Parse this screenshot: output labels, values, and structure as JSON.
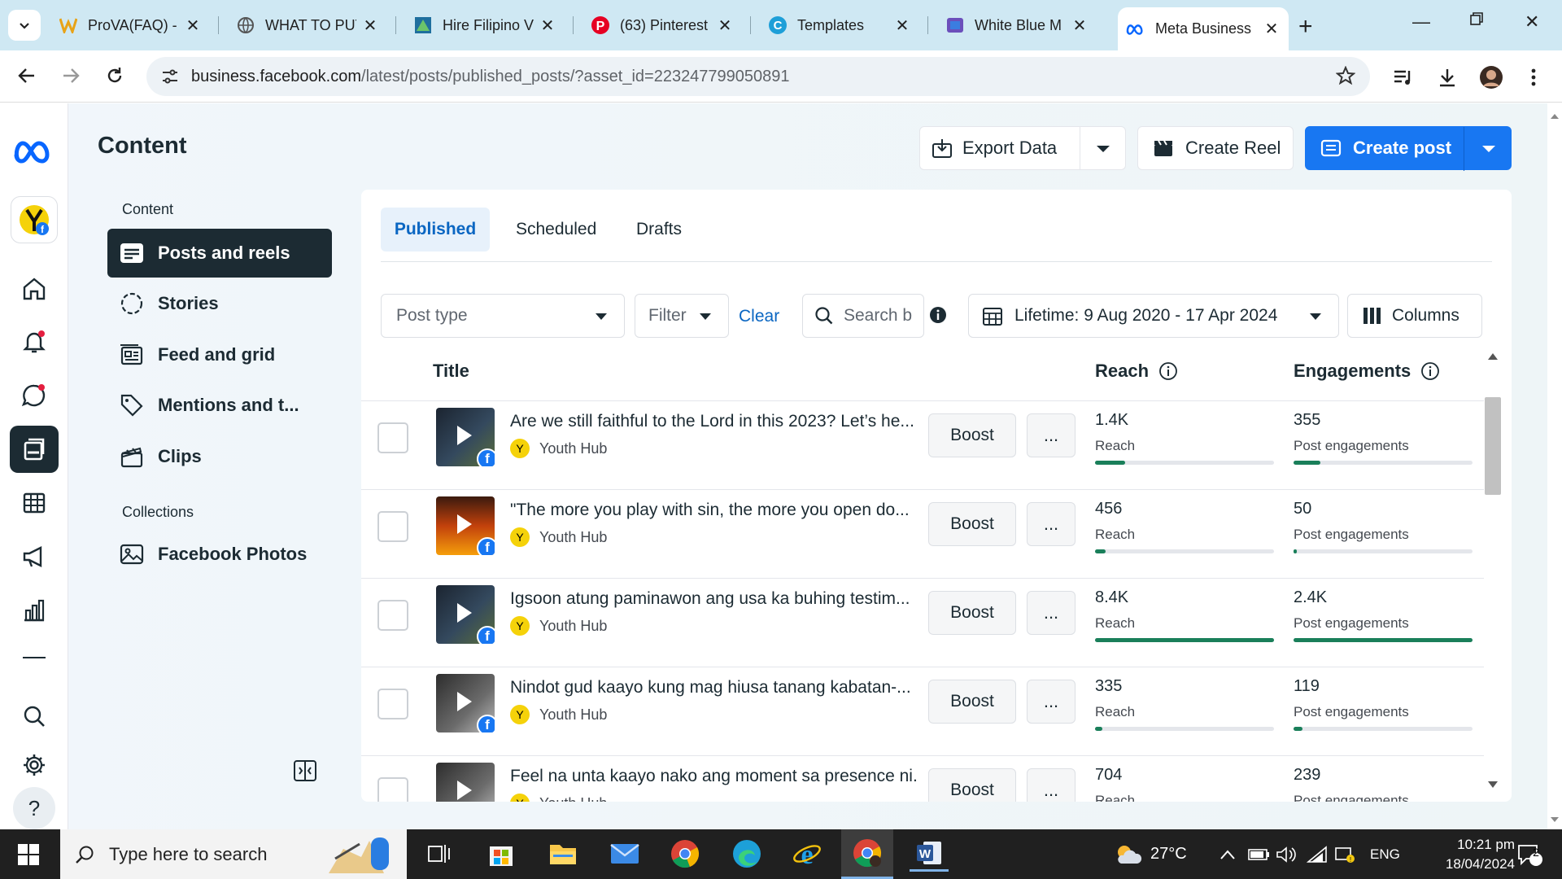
{
  "browser": {
    "tabs": [
      {
        "label": "ProVA(FAQ) - ",
        "icon": "wps-icon",
        "active": false
      },
      {
        "label": "WHAT TO PUT",
        "icon": "globe-icon",
        "active": false
      },
      {
        "label": "Hire Filipino V",
        "icon": "onlinejobs-icon",
        "active": false
      },
      {
        "label": "(63) Pinterest",
        "icon": "pinterest-icon",
        "active": false
      },
      {
        "label": "Templates",
        "icon": "canva-icon",
        "active": false
      },
      {
        "label": "White Blue M",
        "icon": "forms-icon",
        "active": false
      },
      {
        "label": "Meta Business",
        "icon": "meta-icon",
        "active": true
      }
    ],
    "url_host": "business.facebook.com",
    "url_path": "/latest/posts/published_posts/?asset_id=223247799050891"
  },
  "app": {
    "title": "Content",
    "rail_icons": [
      "meta-logo-icon",
      "page-avatar",
      "home-icon",
      "bell-icon",
      "chat-icon",
      "content-icon",
      "table-icon",
      "megaphone-icon",
      "insights-icon",
      "divider",
      "search-icon",
      "gear-icon",
      "help-icon"
    ]
  },
  "leftnav": {
    "section_content": "Content",
    "items": [
      {
        "label": "Posts and reels",
        "icon": "posts-icon",
        "active": true
      },
      {
        "label": "Stories",
        "icon": "stories-icon",
        "active": false
      },
      {
        "label": "Feed and grid",
        "icon": "feed-grid-icon",
        "active": false
      },
      {
        "label": "Mentions and t...",
        "icon": "tag-icon",
        "active": false
      },
      {
        "label": "Clips",
        "icon": "clips-icon",
        "active": false
      }
    ],
    "section_collections": "Collections",
    "collections": [
      {
        "label": "Facebook Photos",
        "icon": "photo-icon"
      }
    ]
  },
  "toolbar": {
    "export_label": "Export Data",
    "create_reel_label": "Create Reel",
    "create_post_label": "Create post"
  },
  "tabs": {
    "published": "Published",
    "scheduled": "Scheduled",
    "drafts": "Drafts"
  },
  "filters": {
    "post_type_placeholder": "Post type",
    "filter_label": "Filter",
    "clear_label": "Clear",
    "search_placeholder": "Search b",
    "date_range": "Lifetime: 9 Aug 2020 - 17 Apr 2024",
    "columns_label": "Columns"
  },
  "table": {
    "col_title": "Title",
    "col_reach": "Reach",
    "col_engagements": "Engagements",
    "boost_label": "Boost",
    "more_label": "...",
    "rows": [
      {
        "title": "Are we still faithful to the Lord in this 2023?  Let’s he...",
        "page": "Youth Hub",
        "reach": "1.4K",
        "reach_label": "Reach",
        "reach_fraction": 0.17,
        "engagements": "355",
        "eng_label": "Post engagements",
        "eng_fraction": 0.15,
        "thumb": "dark"
      },
      {
        "title": "\"The more you play with sin, the more you open do...",
        "page": "Youth Hub",
        "reach": "456",
        "reach_label": "Reach",
        "reach_fraction": 0.06,
        "engagements": "50",
        "eng_label": "Post engagements",
        "eng_fraction": 0.02,
        "thumb": "fire"
      },
      {
        "title": "Igsoon atung paminawon ang usa ka buhing testim...",
        "page": "Youth Hub",
        "reach": "8.4K",
        "reach_label": "Reach",
        "reach_fraction": 1.0,
        "engagements": "2.4K",
        "eng_label": "Post engagements",
        "eng_fraction": 1.0,
        "thumb": "dark"
      },
      {
        "title": "Nindot gud kaayo kung mag hiusa tanang kabatan-...",
        "page": "Youth Hub",
        "reach": "335",
        "reach_label": "Reach",
        "reach_fraction": 0.04,
        "engagements": "119",
        "eng_label": "Post engagements",
        "eng_fraction": 0.05,
        "thumb": "gray"
      },
      {
        "title": "Feel na unta kaayo nako ang moment sa presence ni...",
        "page": "Youth Hub",
        "reach": "704",
        "reach_label": "Reach",
        "reach_fraction": 0.08,
        "engagements": "239",
        "eng_label": "Post engagements",
        "eng_fraction": 0.1,
        "thumb": "gray"
      }
    ]
  },
  "taskbar": {
    "search_placeholder": "Type here to search",
    "temperature": "27°C",
    "language": "ENG",
    "time": "10:21 pm",
    "date": "18/04/2024",
    "notifications": "2"
  },
  "colors": {
    "accent": "#0a66c2",
    "primary_button": "#1877f2",
    "active_nav": "#1c2b33",
    "bar_fill": "#1a7f5a"
  }
}
